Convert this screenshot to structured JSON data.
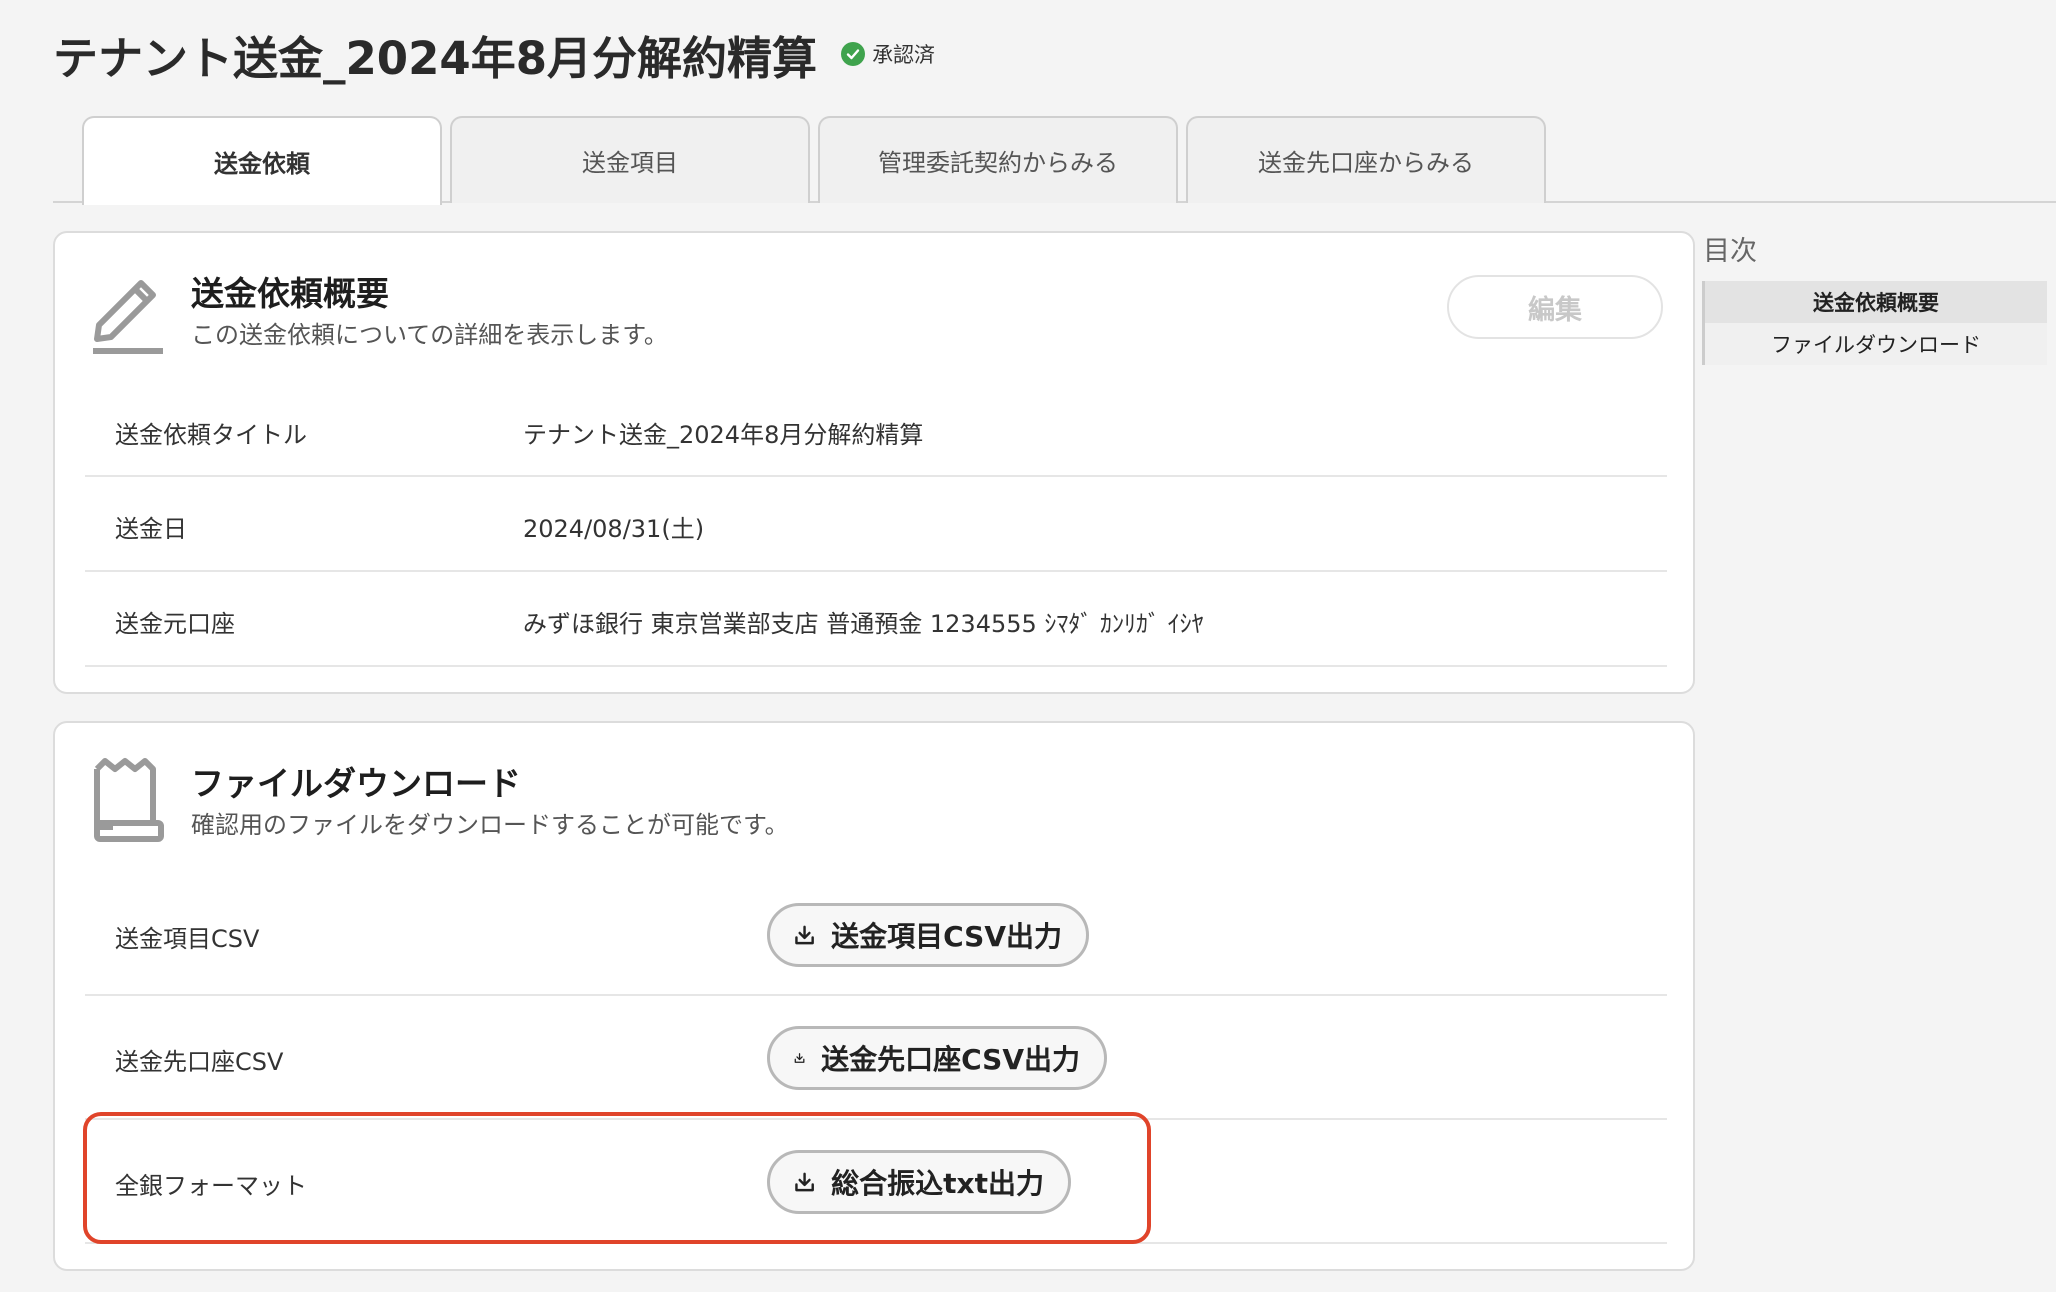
{
  "header": {
    "title": "テナント送金_2024年8月分解約精算",
    "status": "承認済",
    "status_color": "#3fa34d"
  },
  "tabs": [
    {
      "label": "送金依頼",
      "active": true
    },
    {
      "label": "送金項目",
      "active": false
    },
    {
      "label": "管理委託契約からみる",
      "active": false
    },
    {
      "label": "送金先口座からみる",
      "active": false
    }
  ],
  "overview": {
    "icon": "pencil-icon",
    "title": "送金依頼概要",
    "description": "この送金依頼についての詳細を表示します。",
    "edit_label": "編集",
    "rows": [
      {
        "label": "送金依頼タイトル",
        "value": "テナント送金_2024年8月分解約精算"
      },
      {
        "label": "送金日",
        "value": "2024/08/31(土)"
      },
      {
        "label": "送金元口座",
        "value": "みずほ銀行 東京営業部支店 普通預金 1234555 ｼﾏﾀﾞ ｶﾝﾘｶﾞ ｲｼﾔ"
      }
    ]
  },
  "download": {
    "icon": "scroll-icon",
    "title": "ファイルダウンロード",
    "description": "確認用のファイルをダウンロードすることが可能です。",
    "rows": [
      {
        "label": "送金項目CSV",
        "button": "送金項目CSV出力"
      },
      {
        "label": "送金先口座CSV",
        "button": "送金先口座CSV出力"
      },
      {
        "label": "全銀フォーマット",
        "button": "総合振込txt出力"
      }
    ],
    "highlight_color": "#e0442a"
  },
  "toc": {
    "title": "目次",
    "items": [
      {
        "label": "送金依頼概要",
        "active": true
      },
      {
        "label": "ファイルダウンロード",
        "active": false
      }
    ]
  }
}
